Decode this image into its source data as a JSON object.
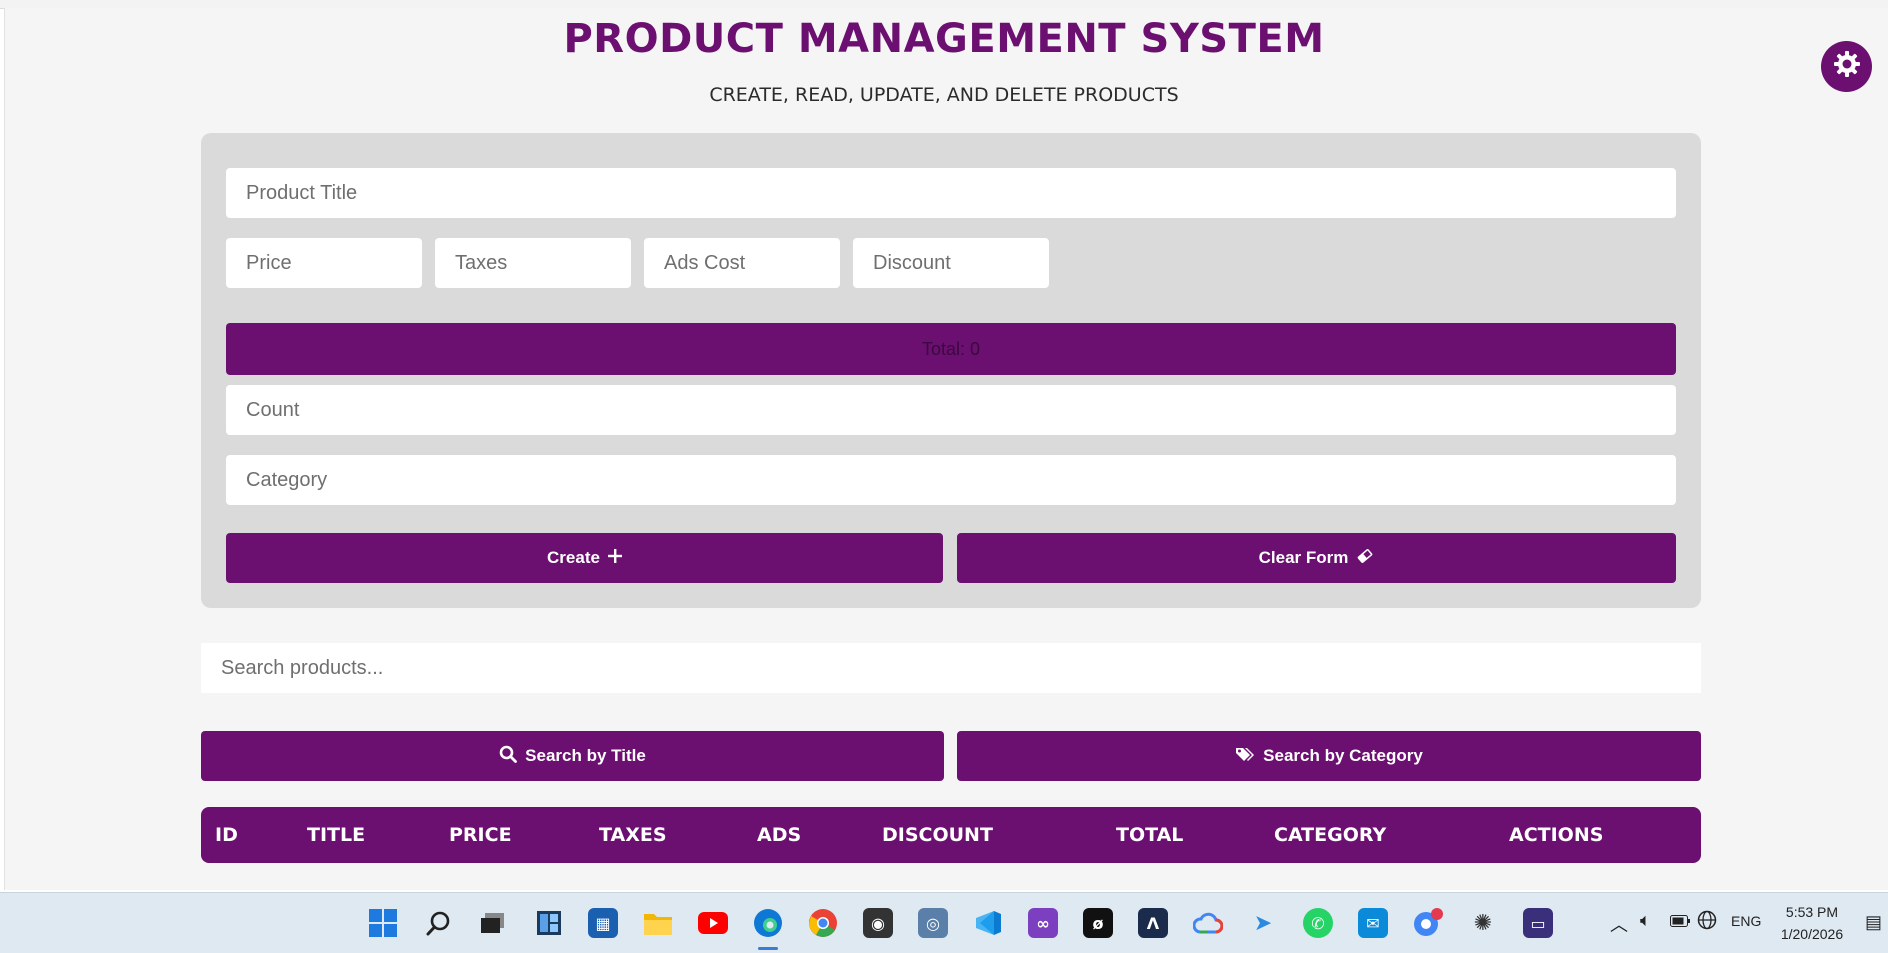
{
  "header": {
    "title": "PRODUCT MANAGEMENT SYSTEM",
    "subtitle": "CREATE, READ, UPDATE, AND DELETE PRODUCTS",
    "theme_icon": "gear-icon"
  },
  "form": {
    "title_placeholder": "Product Title",
    "price_placeholder": "Price",
    "taxes_placeholder": "Taxes",
    "ads_placeholder": "Ads Cost",
    "discount_placeholder": "Discount",
    "total_label": "Total: 0",
    "count_placeholder": "Count",
    "category_placeholder": "Category",
    "create_label": "Create",
    "create_icon": "plus-icon",
    "clear_label": "Clear Form",
    "clear_icon": "eraser-icon"
  },
  "search": {
    "placeholder": "Search products...",
    "by_title_label": "Search by Title",
    "by_title_icon": "search-icon",
    "by_category_label": "Search by Category",
    "by_category_icon": "tags-icon"
  },
  "table": {
    "columns": [
      "ID",
      "TITLE",
      "PRICE",
      "TAXES",
      "ADS",
      "DISCOUNT",
      "TOTAL",
      "CATEGORY",
      "ACTIONS"
    ]
  },
  "taskbar": {
    "language": "ENG",
    "time": "5:53 PM",
    "date": "1/20/2026"
  },
  "colors": {
    "accent": "#6b0f70",
    "panel": "#dadada",
    "page_background": "#f5f5f5"
  }
}
